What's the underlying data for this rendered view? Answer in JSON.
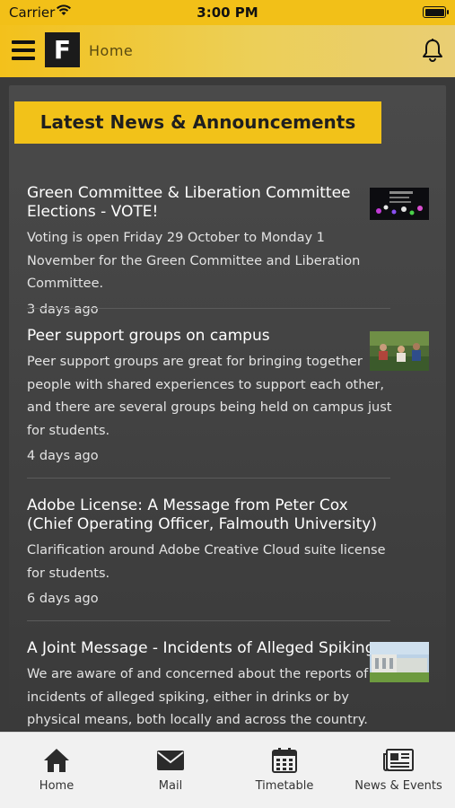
{
  "status": {
    "carrier": "Carrier",
    "time": "3:00 PM"
  },
  "nav": {
    "title": "Home",
    "logo_letter": "F"
  },
  "section": {
    "heading": "Latest News & Announcements"
  },
  "news": [
    {
      "title": "Green Committee & Liberation Committee Elections - VOTE!",
      "body": "Voting is open Friday 29 October to Monday 1 November for the Green Committee and Liberation Committee.",
      "age": "3 days ago"
    },
    {
      "title": "Peer support groups on campus",
      "body": "Peer support groups are great for bringing together people with shared experiences to support each other, and there are several groups being held on campus just for students.",
      "age": "4 days ago"
    },
    {
      "title": "Adobe License: A Message from Peter Cox (Chief Operating Officer, Falmouth University)",
      "body": "Clarification around Adobe Creative Cloud suite license for students.",
      "age": "6 days ago"
    },
    {
      "title": "A Joint Message - Incidents of Alleged Spiking",
      "body": "We are aware of and concerned about the reports of incidents of alleged spiking, either in drinks or by physical means, both locally and across the country.",
      "age": ""
    }
  ],
  "tabs": [
    {
      "label": "Home",
      "icon": "home-icon"
    },
    {
      "label": "Mail",
      "icon": "mail-icon"
    },
    {
      "label": "Timetable",
      "icon": "calendar-icon"
    },
    {
      "label": "News & Events",
      "icon": "newspaper-icon"
    }
  ],
  "colors": {
    "brand_yellow": "#f2c219",
    "background": "#3a3a3a",
    "tabbar": "#f1f1f1"
  }
}
